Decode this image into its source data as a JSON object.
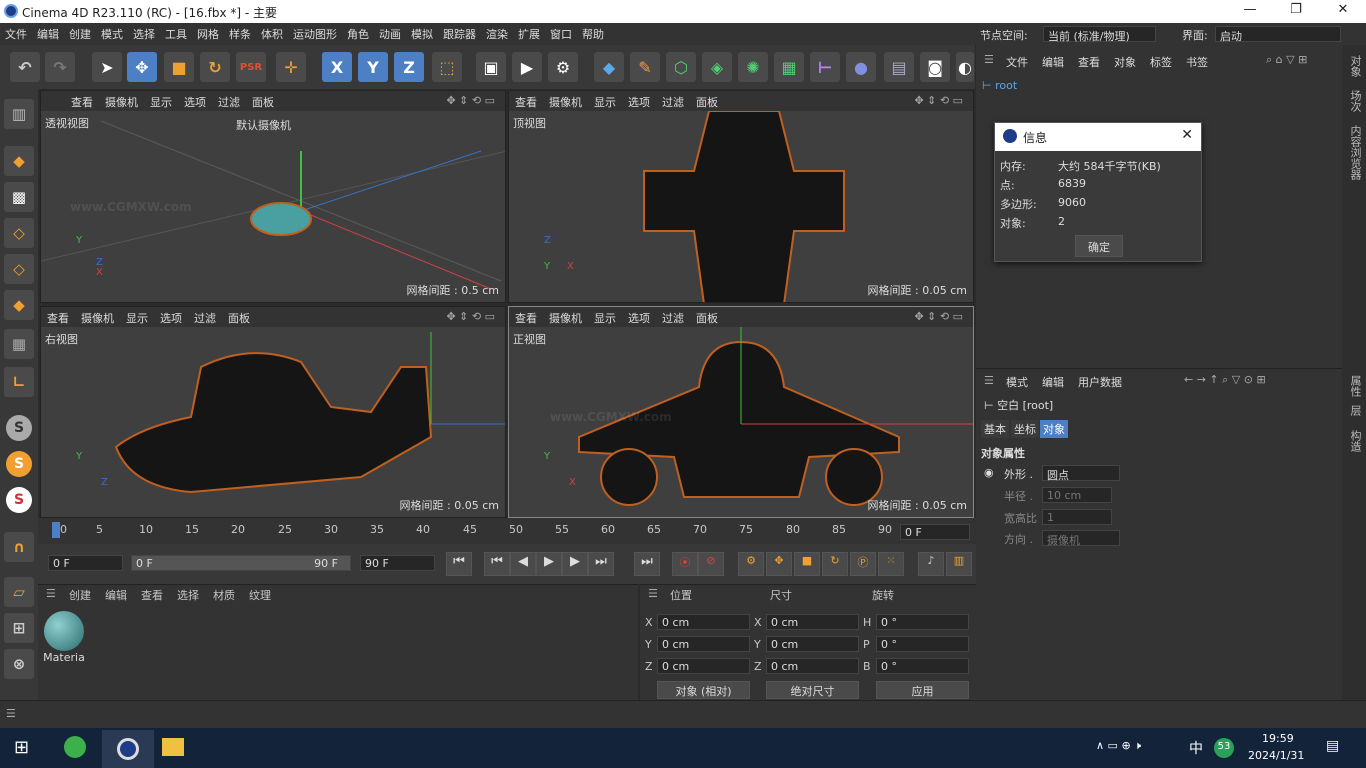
{
  "window": {
    "title": "Cinema 4D R23.110 (RC) - [16.fbx *] - 主要",
    "minimize": "—",
    "maximize": "❐",
    "close": "✕"
  },
  "menu": [
    "文件",
    "编辑",
    "创建",
    "模式",
    "选择",
    "工具",
    "网格",
    "样条",
    "体积",
    "运动图形",
    "角色",
    "动画",
    "模拟",
    "跟踪器",
    "渲染",
    "扩展",
    "窗口",
    "帮助"
  ],
  "node_space": {
    "label": "节点空间:",
    "value": "当前 (标准/物理)"
  },
  "layout": {
    "label": "界面:",
    "value": "启动"
  },
  "toolbar": {
    "axis_x": "X",
    "axis_y": "Y",
    "axis_z": "Z"
  },
  "viewport_menu": [
    "查看",
    "摄像机",
    "显示",
    "选项",
    "过滤",
    "面板"
  ],
  "viewports": {
    "perspective": {
      "name": "透视视图",
      "camera": "默认摄像机",
      "grid": "网格间距 : 0.5 cm"
    },
    "top": {
      "name": "顶视图",
      "grid": "网格间距 : 0.05 cm"
    },
    "right": {
      "name": "右视图",
      "grid": "网格间距 : 0.05 cm"
    },
    "front": {
      "name": "正视图",
      "grid": "网格间距 : 0.05 cm"
    }
  },
  "axes": {
    "x": "X",
    "y": "Y",
    "z": "Z"
  },
  "objects_panel": {
    "menu": [
      "文件",
      "编辑",
      "查看",
      "对象",
      "标签",
      "书签"
    ],
    "root": "root"
  },
  "info_dialog": {
    "title": "信息",
    "rows": [
      {
        "label": "内存:",
        "value": "大约 584千字节(KB)"
      },
      {
        "label": "点:",
        "value": "6839"
      },
      {
        "label": "多边形:",
        "value": "9060"
      },
      {
        "label": "对象:",
        "value": "2"
      }
    ],
    "ok": "确定"
  },
  "attributes": {
    "menu": [
      "模式",
      "编辑",
      "用户数据"
    ],
    "object": "空白 [root]",
    "tabs": [
      "基本",
      "坐标",
      "对象"
    ],
    "section": "对象属性",
    "props": [
      {
        "label": "外形 .",
        "value": "圆点"
      },
      {
        "label": "半径 .",
        "value": "10 cm"
      },
      {
        "label": "宽高比",
        "value": "1"
      },
      {
        "label": "方向 .",
        "value": "摄像机"
      }
    ]
  },
  "right_strip": [
    "对象",
    "场次",
    "内容浏览器",
    "属性",
    "层",
    "构造"
  ],
  "timeline": {
    "ticks": [
      "0",
      "5",
      "10",
      "15",
      "20",
      "25",
      "30",
      "35",
      "40",
      "45",
      "50",
      "55",
      "60",
      "65",
      "70",
      "75",
      "80",
      "85",
      "90"
    ],
    "end_frame": "0 F"
  },
  "transport": {
    "start": "0 F",
    "range_start": "0 F",
    "range_end": "90 F",
    "end": "90 F"
  },
  "materials": {
    "menu": [
      "创建",
      "编辑",
      "查看",
      "选择",
      "材质",
      "纹理"
    ],
    "item": "Materia"
  },
  "coords": {
    "headers": [
      "位置",
      "尺寸",
      "旋转"
    ],
    "rows": [
      {
        "a": "X",
        "pos": "0 cm",
        "b": "X",
        "size": "0 cm",
        "c": "H",
        "rot": "0 °"
      },
      {
        "a": "Y",
        "pos": "0 cm",
        "b": "Y",
        "size": "0 cm",
        "c": "P",
        "rot": "0 °"
      },
      {
        "a": "Z",
        "pos": "0 cm",
        "b": "Z",
        "size": "0 cm",
        "c": "B",
        "rot": "0 °"
      }
    ],
    "mode": "对象 (相对)",
    "size_mode": "绝对尺寸",
    "apply": "应用"
  },
  "taskbar": {
    "ime": "中",
    "badge": "53",
    "time": "19:59",
    "date": "2024/1/31"
  },
  "watermark": "www.CGMXW.com",
  "colors": {
    "accent": "#4d7fc4",
    "orange": "#f0a030",
    "bg": "#2b2b2b"
  }
}
